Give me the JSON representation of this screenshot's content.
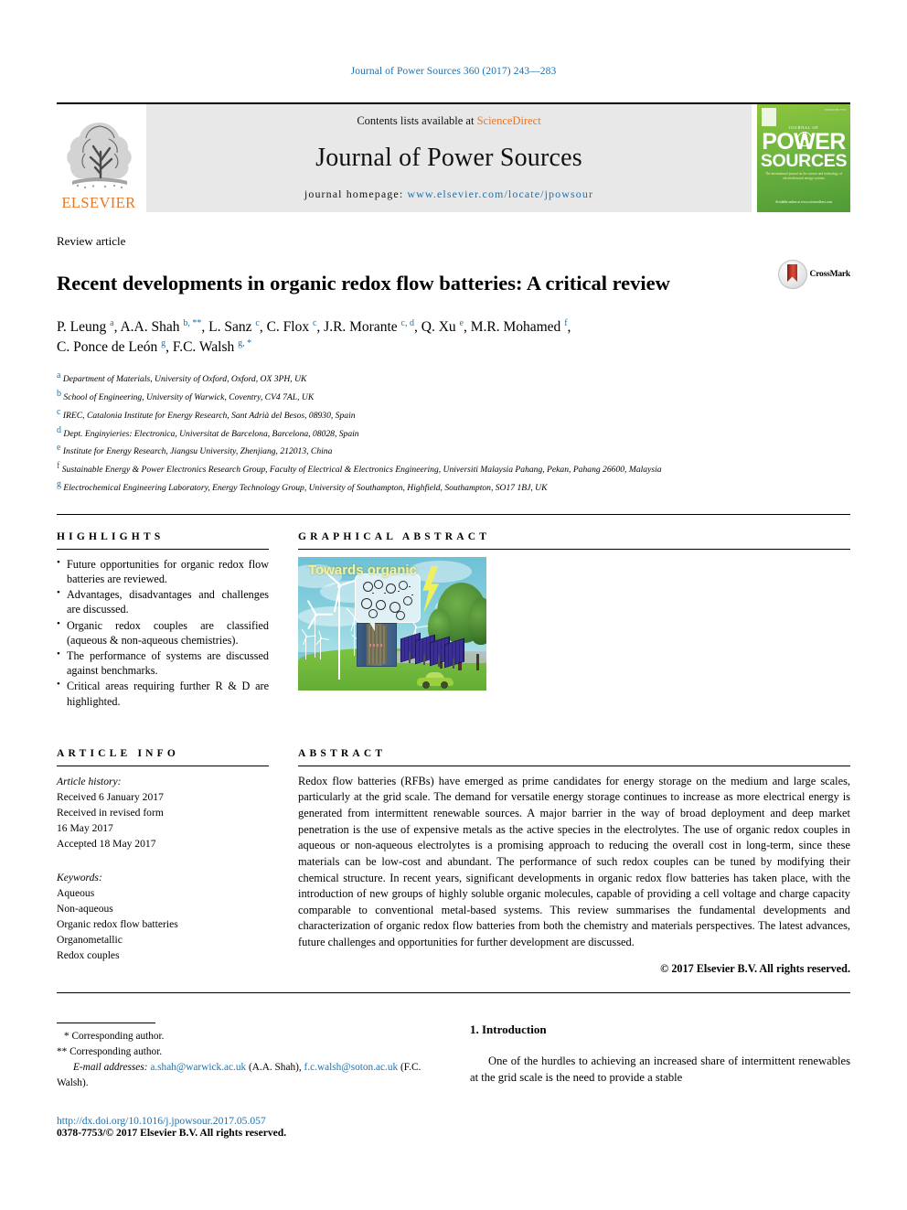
{
  "running_head": "Journal of Power Sources 360 (2017) 243—283",
  "masthead": {
    "contents_prefix": "Contents lists available at ",
    "sciencedirect": "ScienceDirect",
    "journal_name": "Journal of Power Sources",
    "homepage_prefix": "journal homepage: ",
    "homepage_url": "www.elsevier.com/locate/jpowsour",
    "elsevier_wordmark": "ELSEVIER",
    "cover": {
      "jos": "JOURNAL OF",
      "power": "POWER",
      "sources": "SOURCES",
      "subtitle": "The international journal on the science and technology of electrochemical energy systems",
      "bottom": "Available online at\nwww.sciencedirect.com",
      "issn": "ISSN 0378-7753"
    }
  },
  "article": {
    "type": "Review article",
    "title": "Recent developments in organic redox flow batteries: A critical review",
    "crossmark_label": "CrossMark",
    "authors_line1": "P. Leung a, A.A. Shah b, **, L. Sanz c, C. Flox c, J.R. Morante c, d, Q. Xu e, M.R. Mohamed f,",
    "authors_line2": "C. Ponce de León g, F.C. Walsh g, *",
    "authors": [
      {
        "name": "P. Leung",
        "marks": "a"
      },
      {
        "name": "A.A. Shah",
        "marks": "b, **"
      },
      {
        "name": "L. Sanz",
        "marks": "c"
      },
      {
        "name": "C. Flox",
        "marks": "c"
      },
      {
        "name": "J.R. Morante",
        "marks": "c, d"
      },
      {
        "name": "Q. Xu",
        "marks": "e"
      },
      {
        "name": "M.R. Mohamed",
        "marks": "f"
      },
      {
        "name": "C. Ponce de León",
        "marks": "g"
      },
      {
        "name": "F.C. Walsh",
        "marks": "g, *"
      }
    ],
    "affiliations": [
      {
        "mark": "a",
        "text": "Department of Materials, University of Oxford, Oxford, OX 3PH, UK"
      },
      {
        "mark": "b",
        "text": "School of Engineering, University of Warwick, Coventry, CV4 7AL, UK"
      },
      {
        "mark": "c",
        "text": "IREC, Catalonia Institute for Energy Research, Sant Adrià del Besos, 08930, Spain"
      },
      {
        "mark": "d",
        "text": "Dept. Enginyieries: Electronica, Universitat de Barcelona, Barcelona, 08028, Spain"
      },
      {
        "mark": "e",
        "text": "Institute for Energy Research, Jiangsu University, Zhenjiang, 212013, China"
      },
      {
        "mark": "f",
        "text": "Sustainable Energy & Power Electronics Research Group, Faculty of Electrical & Electronics Engineering, Universiti Malaysia Pahang, Pekan, Pahang 26600, Malaysia"
      },
      {
        "mark": "g",
        "text": "Electrochemical Engineering Laboratory, Energy Technology Group, University of Southampton, Highfield, Southampton, SO17 1BJ, UK"
      }
    ]
  },
  "highlights": {
    "heading": "HIGHLIGHTS",
    "items": [
      "Future opportunities for organic redox flow batteries are reviewed.",
      "Advantages, disadvantages and challenges are discussed.",
      "Organic redox couples are classified (aqueous & non-aqueous chemistries).",
      "The performance of systems are discussed against benchmarks.",
      "Critical areas requiring further R & D are highlighted."
    ]
  },
  "graphical_abstract": {
    "heading": "GRAPHICAL ABSTRACT",
    "caption": "Towards organic"
  },
  "article_info": {
    "heading": "ARTICLE INFO",
    "history_label": "Article history:",
    "history": [
      "Received 6 January 2017",
      "Received in revised form",
      "16 May 2017",
      "Accepted 18 May 2017"
    ],
    "keywords_label": "Keywords:",
    "keywords": [
      "Aqueous",
      "Non-aqueous",
      "Organic redox flow batteries",
      "Organometallic",
      "Redox couples"
    ]
  },
  "abstract": {
    "heading": "ABSTRACT",
    "text": "Redox flow batteries (RFBs) have emerged as prime candidates for energy storage on the medium and large scales, particularly at the grid scale. The demand for versatile energy storage continues to increase as more electrical energy is generated from intermittent renewable sources. A major barrier in the way of broad deployment and deep market penetration is the use of expensive metals as the active species in the electrolytes. The use of organic redox couples in aqueous or non-aqueous electrolytes is a promising approach to reducing the overall cost in long-term, since these materials can be low-cost and abundant. The performance of such redox couples can be tuned by modifying their chemical structure. In recent years, significant developments in organic redox flow batteries has taken place, with the introduction of new groups of highly soluble organic molecules, capable of providing a cell voltage and charge capacity comparable to conventional metal-based systems. This review summarises the fundamental developments and characterization of organic redox flow batteries from both the chemistry and materials perspectives. The latest advances, future challenges and opportunities for further development are discussed.",
    "copyright": "© 2017 Elsevier B.V. All rights reserved."
  },
  "footnotes": {
    "corresponding_1": "* Corresponding author.",
    "corresponding_2": "** Corresponding author.",
    "email_label": "E-mail addresses:",
    "email_1": "a.shah@warwick.ac.uk",
    "email_1_owner": "(A.A. Shah),",
    "email_2": "f.c.walsh@soton.ac.uk",
    "email_2_owner": "(F.C. Walsh).",
    "doi": "http://dx.doi.org/10.1016/j.jpowsour.2017.05.057",
    "issn": "0378-7753/© 2017 Elsevier B.V. All rights reserved."
  },
  "introduction": {
    "heading": "1. Introduction",
    "text": "One of the hurdles to achieving an increased share of intermittent renewables at the grid scale is the need to provide a stable"
  },
  "colors": {
    "link_blue": "#1a72b0",
    "elsevier_orange": "#e87722",
    "cover_green": "#6cb33f",
    "crossmark_red": "#c0392b"
  }
}
